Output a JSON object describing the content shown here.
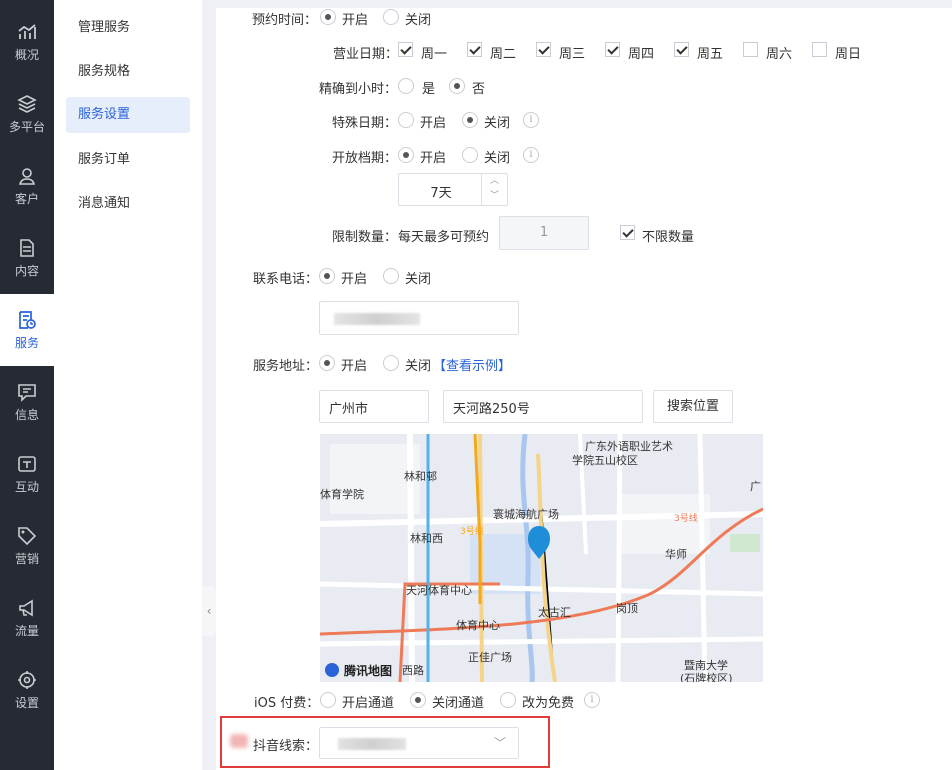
{
  "nav": [
    {
      "label": "概况",
      "icon": "chart-icon"
    },
    {
      "label": "多平台",
      "icon": "layers-icon"
    },
    {
      "label": "客户",
      "icon": "user-icon"
    },
    {
      "label": "内容",
      "icon": "document-icon"
    },
    {
      "label": "服务",
      "icon": "service-icon"
    },
    {
      "label": "信息",
      "icon": "message-icon"
    },
    {
      "label": "互动",
      "icon": "interaction-icon"
    },
    {
      "label": "营销",
      "icon": "tag-icon"
    },
    {
      "label": "流量",
      "icon": "megaphone-icon"
    },
    {
      "label": "设置",
      "icon": "gear-icon"
    }
  ],
  "submenu": [
    "管理服务",
    "服务规格",
    "服务设置",
    "服务订单",
    "消息通知"
  ],
  "form": {
    "booking_time": {
      "label": "预约时间：",
      "on": "开启",
      "off": "关闭"
    },
    "business_days": {
      "label": "营业日期：",
      "days": [
        {
          "name": "周一",
          "checked": true
        },
        {
          "name": "周二",
          "checked": true
        },
        {
          "name": "周三",
          "checked": true
        },
        {
          "name": "周四",
          "checked": true
        },
        {
          "name": "周五",
          "checked": true
        },
        {
          "name": "周六",
          "checked": false
        },
        {
          "name": "周日",
          "checked": false
        }
      ]
    },
    "precise_hour": {
      "label": "精确到小时：",
      "yes": "是",
      "no": "否"
    },
    "special_date": {
      "label": "特殊日期：",
      "on": "开启",
      "off": "关闭"
    },
    "open_period": {
      "label": "开放档期：",
      "on": "开启",
      "off": "关闭",
      "value": "7天"
    },
    "limit": {
      "label": "限制数量：",
      "prefix": "每天最多可预约",
      "value": "1",
      "unlimited": "不限数量"
    },
    "phone": {
      "label": "联系电话：",
      "on": "开启",
      "off": "关闭"
    },
    "address": {
      "label": "服务地址：",
      "on": "开启",
      "off": "关闭",
      "example": "【查看示例】",
      "city": "广州市",
      "street": "天河路250号",
      "search": "搜索位置"
    },
    "map": {
      "brand": "腾讯地图",
      "places": [
        "广东外语职业艺术",
        "学院五山校区",
        "林和邨",
        "体育学院",
        "寰城海航广场",
        "林和西",
        "华师",
        "天河体育中心",
        "太古汇",
        "岗顶",
        "体育中心",
        "正佳广场",
        "暨南大学",
        "(石牌校区)",
        "西路",
        "3号线",
        "3号线",
        "广"
      ]
    },
    "ios": {
      "label": "iOS 付费：",
      "open": "开启通道",
      "close": "关闭通道",
      "free": "改为免费"
    },
    "douyin": {
      "label": "抖音线索："
    }
  }
}
